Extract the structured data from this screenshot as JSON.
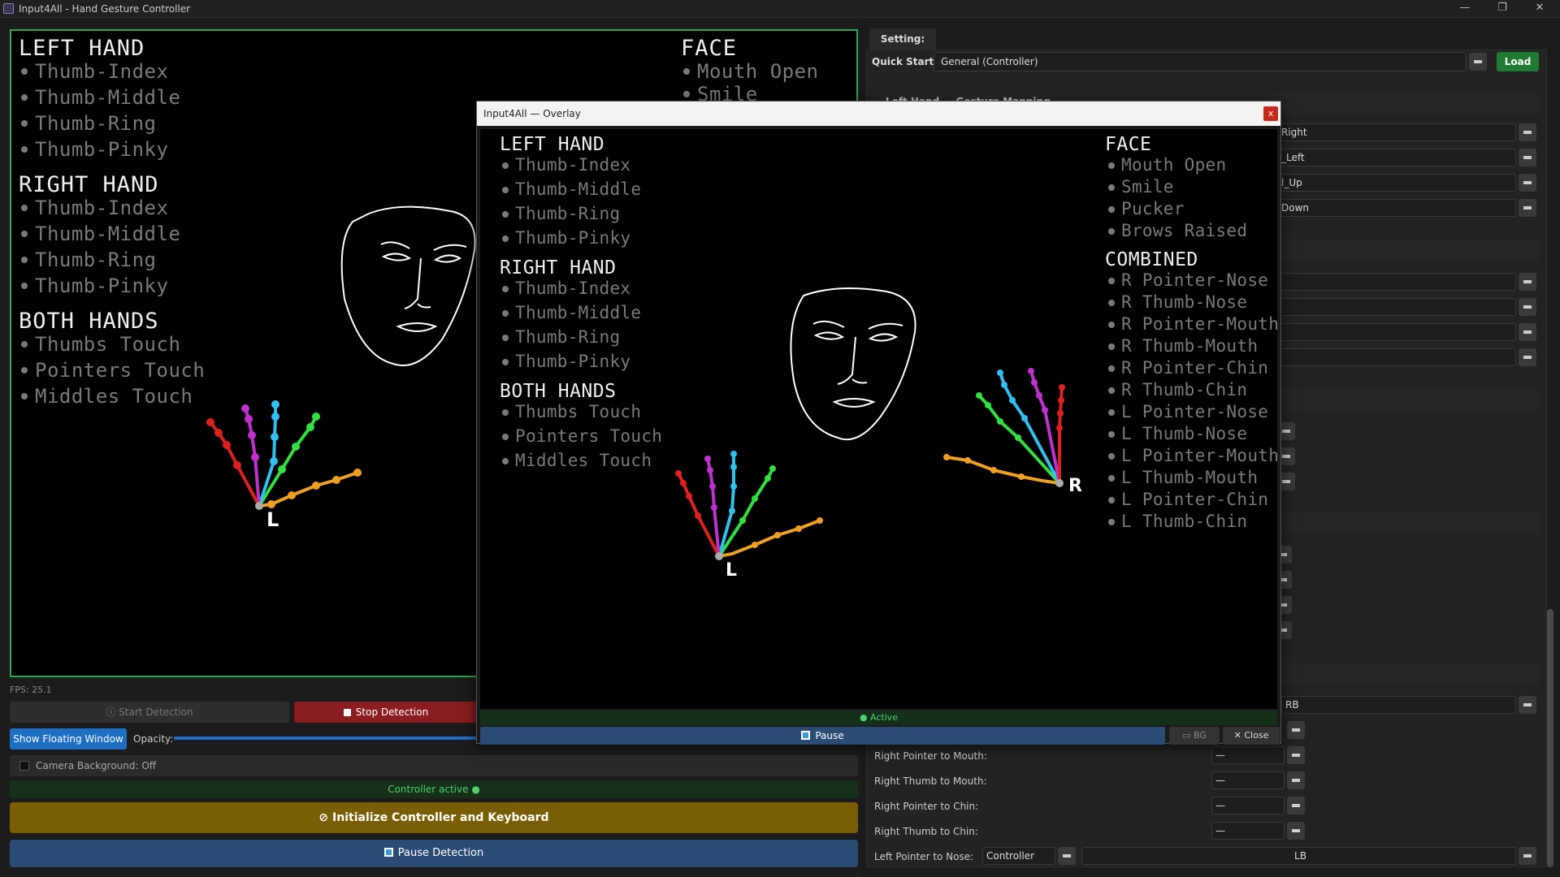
{
  "window": {
    "title": "Input4All - Hand Gesture Controller"
  },
  "camera": {
    "left_hand": {
      "title": "LEFT HAND",
      "items": [
        "Thumb-Index",
        "Thumb-Middle",
        "Thumb-Ring",
        "Thumb-Pinky"
      ]
    },
    "right_hand": {
      "title": "RIGHT HAND",
      "items": [
        "Thumb-Index",
        "Thumb-Middle",
        "Thumb-Ring",
        "Thumb-Pinky"
      ]
    },
    "both_hands": {
      "title": "BOTH HANDS",
      "items": [
        "Thumbs Touch",
        "Pointers Touch",
        "Middles Touch"
      ]
    },
    "face": {
      "title": "FACE",
      "items": [
        "Mouth Open",
        "Smile"
      ]
    },
    "hand_label": "L"
  },
  "fps": "FPS: 25.1",
  "controls": {
    "start": "Start Detection",
    "stop": "Stop Detection",
    "floating": "Show Floating Window",
    "opacity": "Opacity:",
    "camera_bg": "Camera Background: Off",
    "controller_status": "Controller active ●",
    "init": "Initialize Controller and Keyboard",
    "pause": "Pause Detection"
  },
  "settings": {
    "tab": "Setting:",
    "quick_start_label": "Quick Start:",
    "quick_start_value": "General (Controller)",
    "load": "Load",
    "section_peek": "Left Hand — Gesture Mapping",
    "partial_values": [
      "Right",
      "_Left",
      "l_Up",
      "Down"
    ],
    "rb": "RB",
    "rows": [
      {
        "label": "Right Pointer to Mouth:",
        "value": "—"
      },
      {
        "label": "Right Thumb to Mouth:",
        "value": "—"
      },
      {
        "label": "Right Pointer to Chin:",
        "value": "—"
      },
      {
        "label": "Right Thumb to Chin:",
        "value": "—"
      }
    ],
    "last_row": {
      "label": "Left Pointer to Nose:",
      "type": "Controller",
      "value": "LB"
    }
  },
  "overlay": {
    "title": "Input4All — Overlay",
    "close_x": "x",
    "left_hand": {
      "title": "LEFT HAND",
      "items": [
        "Thumb-Index",
        "Thumb-Middle",
        "Thumb-Ring",
        "Thumb-Pinky"
      ]
    },
    "right_hand": {
      "title": "RIGHT HAND",
      "items": [
        "Thumb-Index",
        "Thumb-Middle",
        "Thumb-Ring",
        "Thumb-Pinky"
      ]
    },
    "both_hands": {
      "title": "BOTH HANDS",
      "items": [
        "Thumbs Touch",
        "Pointers Touch",
        "Middles Touch"
      ]
    },
    "face": {
      "title": "FACE",
      "items": [
        "Mouth Open",
        "Smile",
        "Pucker",
        "Brows Raised"
      ]
    },
    "combined": {
      "title": "COMBINED",
      "items": [
        "R Pointer-Nose",
        "R Thumb-Nose",
        "R Pointer-Mouth",
        "R Thumb-Mouth",
        "R Pointer-Chin",
        "R Thumb-Chin",
        "L Pointer-Nose",
        "L Thumb-Nose",
        "L Pointer-Mouth",
        "L Thumb-Mouth",
        "L Pointer-Chin",
        "L Thumb-Chin"
      ]
    },
    "left_label": "L",
    "right_label": "R",
    "status": "● Active",
    "pause": "Pause",
    "bg": "BG",
    "close": "Close"
  },
  "colors": {
    "thumb": "#f0a020",
    "index": "#30e040",
    "middle": "#30c0f0",
    "ring": "#c030d0",
    "pinky": "#e02020",
    "accent": "#1e6fc4",
    "stop": "#8b1c1f",
    "init": "#7a5e05"
  }
}
